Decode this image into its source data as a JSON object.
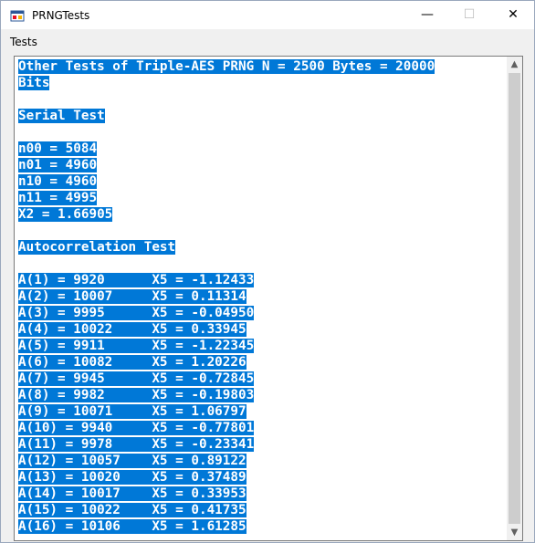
{
  "window": {
    "title": "PRNGTests",
    "icon": "app-window-icon"
  },
  "titlebar_buttons": {
    "minimize": "—",
    "maximize": "☐",
    "close": "✕"
  },
  "menu": {
    "items": [
      "Tests"
    ]
  },
  "output": {
    "lines": [
      "Other Tests of Triple-AES PRNG N = 2500 Bytes = 20000",
      "Bits",
      "",
      "Serial Test",
      "",
      "n00 = 5084",
      "n01 = 4960",
      "n10 = 4960",
      "n11 = 4995",
      "X2 = 1.66905",
      "",
      "Autocorrelation Test",
      "",
      "A(1) = 9920      X5 = -1.12433",
      "A(2) = 10007     X5 = 0.11314",
      "A(3) = 9995      X5 = -0.04950",
      "A(4) = 10022     X5 = 0.33945",
      "A(5) = 9911      X5 = -1.22345",
      "A(6) = 10082     X5 = 1.20226",
      "A(7) = 9945      X5 = -0.72845",
      "A(8) = 9982      X5 = -0.19803",
      "A(9) = 10071     X5 = 1.06797",
      "A(10) = 9940     X5 = -0.77801",
      "A(11) = 9978     X5 = -0.23341",
      "A(12) = 10057    X5 = 0.89122",
      "A(13) = 10020    X5 = 0.37489",
      "A(14) = 10017    X5 = 0.33953",
      "A(15) = 10022    X5 = 0.41735",
      "A(16) = 10106    X5 = 1.61285"
    ]
  },
  "scrollbar": {
    "up_arrow": "▲",
    "down_arrow": "▼"
  },
  "colors": {
    "selection": "#0078d7",
    "selected_text": "#ffffff"
  }
}
